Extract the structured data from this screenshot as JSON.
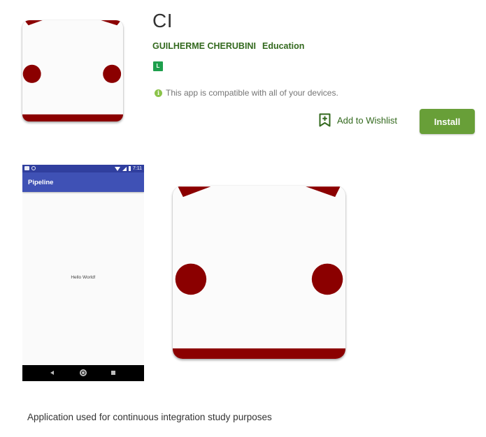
{
  "app": {
    "title": "CI",
    "developer": "GUILHERME CHERUBINI",
    "category": "Education",
    "content_rating": "L",
    "compatibility": "This app is compatible with all of your devices.",
    "description": "Application used for continuous integration study purposes"
  },
  "actions": {
    "wishlist_label": "Add to Wishlist",
    "install_label": "Install"
  },
  "screenshot": {
    "status_time": "7:11",
    "toolbar_title": "Pipeline",
    "body_text": "Hello World!"
  },
  "colors": {
    "accent_green": "#689f38",
    "link_green": "#33691e",
    "icon_red": "#8b0000",
    "toolbar_blue": "#3f51b5",
    "status_blue": "#303f9f",
    "rating_green": "#1e9f4d"
  },
  "icons": [
    "info-icon",
    "bookmark-add-icon",
    "wifi-icon",
    "signal-icon",
    "battery-icon",
    "back-icon",
    "home-icon",
    "recents-icon"
  ]
}
